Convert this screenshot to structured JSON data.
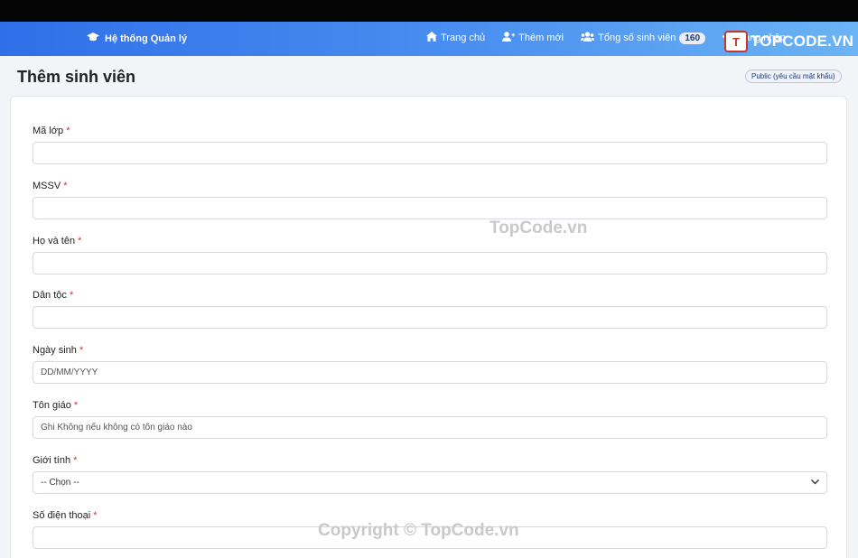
{
  "navbar": {
    "brand": "Hệ thống Quản lý",
    "home": "Trang chủ",
    "add_new": "Thêm mới",
    "total_students": "Tổng số sinh viên",
    "total_count": "160",
    "login": "Đăng nhập"
  },
  "logo": {
    "mark": "T",
    "text": "TOPCODE.VN"
  },
  "page": {
    "title": "Thêm sinh viên",
    "access_badge": "Public (yêu cầu mật khẩu)"
  },
  "form": {
    "class_code": {
      "label": "Mã lớp",
      "required": "*",
      "placeholder": ""
    },
    "student_id": {
      "label": "MSSV",
      "required": "*",
      "placeholder": ""
    },
    "full_name": {
      "label": "Họ và tên",
      "required": "*",
      "placeholder": ""
    },
    "ethnicity": {
      "label": "Dân tộc",
      "required": "*",
      "placeholder": ""
    },
    "birth_date": {
      "label": "Ngày sinh",
      "required": "*",
      "placeholder": "DD/MM/YYYY"
    },
    "religion": {
      "label": "Tôn giáo",
      "required": "*",
      "placeholder": "Ghi Không nếu không có tôn giáo nào"
    },
    "gender": {
      "label": "Giới tính",
      "required": "*",
      "selected": "-- Chọn --"
    },
    "phone": {
      "label": "Số điện thoại",
      "required": "*",
      "placeholder": ""
    }
  },
  "watermarks": {
    "center": "TopCode.vn",
    "bottom": "Copyright © TopCode.vn"
  },
  "colors": {
    "accent": "#2f6fe8",
    "required": "#d6303b"
  }
}
